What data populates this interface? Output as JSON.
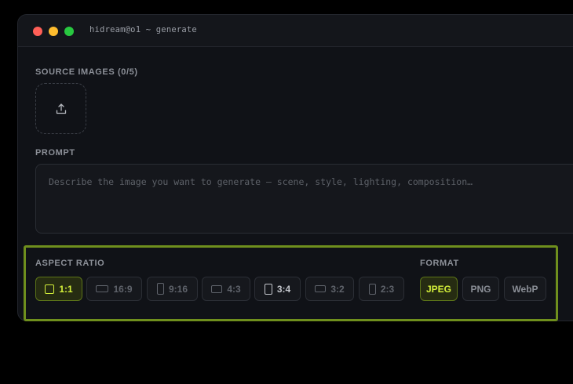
{
  "window": {
    "title": "hidream@o1 ~ generate"
  },
  "source_images": {
    "label": "SOURCE IMAGES (0/5)",
    "upload_icon": "upload-icon"
  },
  "prompt": {
    "label": "PROMPT",
    "value": "",
    "placeholder": "Describe the image you want to generate — scene, style, lighting, composition…"
  },
  "aspect_ratio": {
    "label": "ASPECT RATIO",
    "selected": "1:1",
    "options": [
      {
        "label": "1:1",
        "icon": "square-icon"
      },
      {
        "label": "16:9",
        "icon": "landscape-icon"
      },
      {
        "label": "9:16",
        "icon": "portrait-icon"
      },
      {
        "label": "4:3",
        "icon": "landscape-icon"
      },
      {
        "label": "3:4",
        "icon": "portrait-icon"
      },
      {
        "label": "3:2",
        "icon": "landscape-icon"
      },
      {
        "label": "2:3",
        "icon": "portrait-icon"
      }
    ]
  },
  "format": {
    "label": "FORMAT",
    "selected": "JPEG",
    "options": [
      "JPEG",
      "PNG",
      "WebP"
    ]
  },
  "colors": {
    "accent": "#d4f03a",
    "highlight_border": "#6f8f1d",
    "window_bg": "#101217"
  }
}
